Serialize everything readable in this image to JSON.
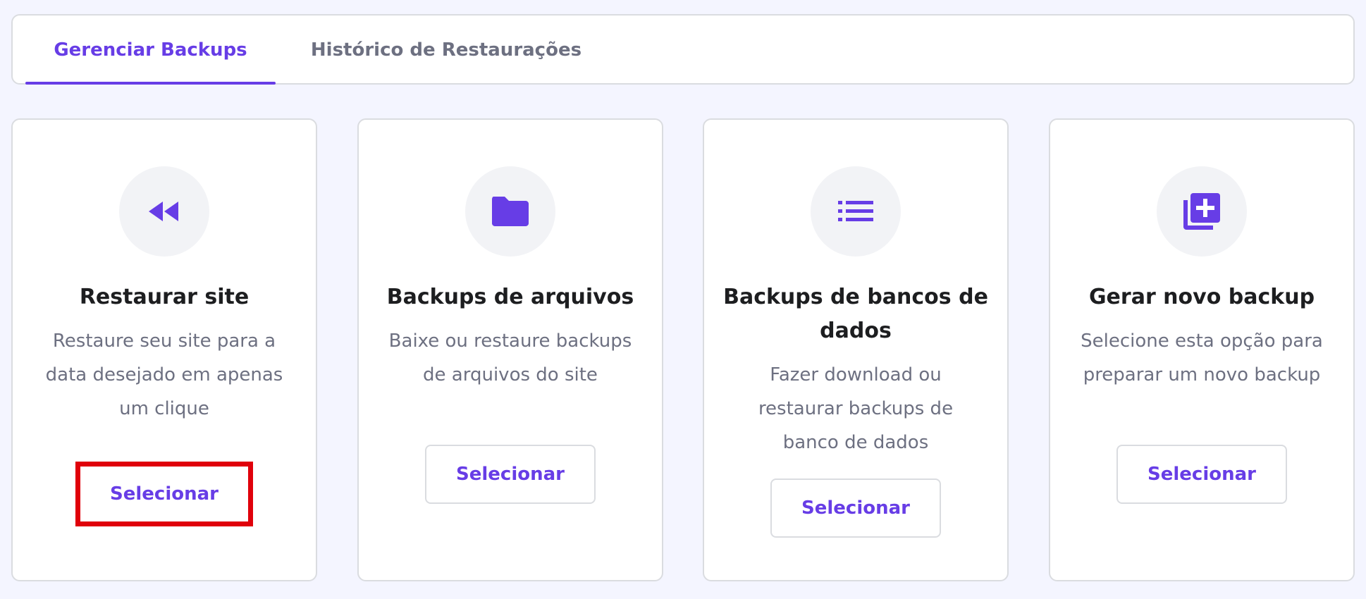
{
  "tabs": [
    {
      "label": "Gerenciar Backups",
      "active": true
    },
    {
      "label": "Histórico de Restaurações",
      "active": false
    }
  ],
  "cards": [
    {
      "icon": "rewind-icon",
      "title": "Restaurar site",
      "description": "Restaure seu site para a data desejado em apenas um clique",
      "button": "Selecionar"
    },
    {
      "icon": "folder-icon",
      "title": "Backups de arquivos",
      "description": "Baixe ou restaure backups de arquivos do site",
      "button": "Selecionar"
    },
    {
      "icon": "list-icon",
      "title": "Backups de bancos de dados",
      "description": "Fazer download ou restaurar backups de banco de dados",
      "button": "Selecionar"
    },
    {
      "icon": "add-library-icon",
      "title": "Gerar novo backup",
      "description": "Selecione esta opção para preparar um novo backup",
      "button": "Selecionar"
    }
  ],
  "colors": {
    "accent": "#673de6",
    "background": "#f4f5ff",
    "highlight": "#e0000b"
  }
}
